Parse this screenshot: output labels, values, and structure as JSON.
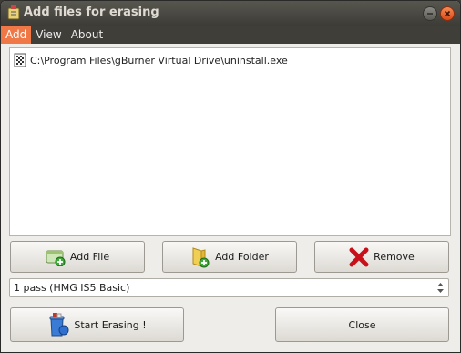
{
  "window": {
    "title": "Add files for erasing"
  },
  "menu": {
    "items": [
      {
        "label": "Add",
        "active": true
      },
      {
        "label": "View",
        "active": false
      },
      {
        "label": "About",
        "active": false
      }
    ]
  },
  "file_list": {
    "items": [
      {
        "path": "C:\\Program Files\\gBurner Virtual Drive\\uninstall.exe",
        "icon": "executable-file-icon"
      }
    ]
  },
  "buttons": {
    "add_file": "Add File",
    "add_folder": "Add Folder",
    "remove": "Remove",
    "start_erasing": "Start Erasing !",
    "close": "Close"
  },
  "erase_method": {
    "selected": "1 pass (HMG IS5 Basic)"
  },
  "colors": {
    "titlebar": "#3d3c37",
    "menu_active": "#f07746",
    "close_button": "#d84a18"
  }
}
